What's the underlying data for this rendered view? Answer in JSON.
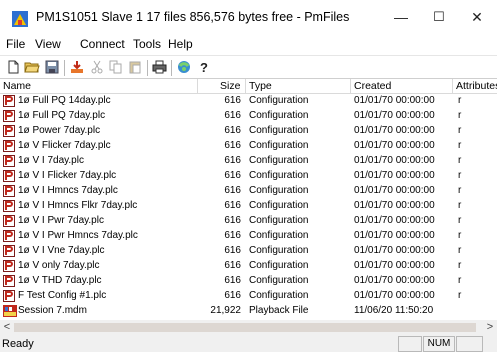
{
  "window": {
    "title": "PM1S1051 Slave 1 17 files 856,576 bytes free - PmFiles"
  },
  "window_controls": {
    "minimize": "—",
    "maximize": "☐",
    "close": "✕"
  },
  "menu": [
    "File",
    "View",
    "Connect",
    "Tools",
    "Help"
  ],
  "toolbar": [
    {
      "name": "new-icon"
    },
    {
      "name": "open-folder-icon"
    },
    {
      "name": "save-icon"
    },
    {
      "name": "download-icon"
    },
    {
      "name": "cut-icon"
    },
    {
      "name": "copy-icon"
    },
    {
      "name": "paste-icon"
    },
    {
      "name": "print-icon"
    },
    {
      "name": "connect-icon"
    },
    {
      "name": "help-icon"
    }
  ],
  "columns": {
    "name": "Name",
    "size": "Size",
    "type": "Type",
    "created": "Created",
    "attributes": "Attributes"
  },
  "files": [
    {
      "name": "1ø Full PQ 14day.plc",
      "size": "616",
      "type": "Configuration",
      "created": "01/01/70 00:00:00",
      "attr": "r",
      "icon": "plc-file-icon"
    },
    {
      "name": "1ø Full PQ 7day.plc",
      "size": "616",
      "type": "Configuration",
      "created": "01/01/70 00:00:00",
      "attr": "r",
      "icon": "plc-file-icon"
    },
    {
      "name": "1ø Power 7day.plc",
      "size": "616",
      "type": "Configuration",
      "created": "01/01/70 00:00:00",
      "attr": "r",
      "icon": "plc-file-icon"
    },
    {
      "name": "1ø V Flicker 7day.plc",
      "size": "616",
      "type": "Configuration",
      "created": "01/01/70 00:00:00",
      "attr": "r",
      "icon": "plc-file-icon"
    },
    {
      "name": "1ø V I 7day.plc",
      "size": "616",
      "type": "Configuration",
      "created": "01/01/70 00:00:00",
      "attr": "r",
      "icon": "plc-file-icon"
    },
    {
      "name": "1ø V I Flicker 7day.plc",
      "size": "616",
      "type": "Configuration",
      "created": "01/01/70 00:00:00",
      "attr": "r",
      "icon": "plc-file-icon"
    },
    {
      "name": "1ø V I Hmncs 7day.plc",
      "size": "616",
      "type": "Configuration",
      "created": "01/01/70 00:00:00",
      "attr": "r",
      "icon": "plc-file-icon"
    },
    {
      "name": "1ø V I Hmncs Flkr 7day.plc",
      "size": "616",
      "type": "Configuration",
      "created": "01/01/70 00:00:00",
      "attr": "r",
      "icon": "plc-file-icon"
    },
    {
      "name": "1ø V I Pwr 7day.plc",
      "size": "616",
      "type": "Configuration",
      "created": "01/01/70 00:00:00",
      "attr": "r",
      "icon": "plc-file-icon"
    },
    {
      "name": "1ø V I Pwr Hmncs 7day.plc",
      "size": "616",
      "type": "Configuration",
      "created": "01/01/70 00:00:00",
      "attr": "r",
      "icon": "plc-file-icon"
    },
    {
      "name": "1ø V I Vne 7day.plc",
      "size": "616",
      "type": "Configuration",
      "created": "01/01/70 00:00:00",
      "attr": "r",
      "icon": "plc-file-icon"
    },
    {
      "name": "1ø V only 7day.plc",
      "size": "616",
      "type": "Configuration",
      "created": "01/01/70 00:00:00",
      "attr": "r",
      "icon": "plc-file-icon"
    },
    {
      "name": "1ø V THD 7day.plc",
      "size": "616",
      "type": "Configuration",
      "created": "01/01/70 00:00:00",
      "attr": "r",
      "icon": "plc-file-icon"
    },
    {
      "name": "F Test Config #1.plc",
      "size": "616",
      "type": "Configuration",
      "created": "01/01/70 00:00:00",
      "attr": "r",
      "icon": "plc-file-icon"
    },
    {
      "name": "Session 7.mdm",
      "size": "21,922",
      "type": "Playback File",
      "created": "11/06/20 11:50:20",
      "attr": "",
      "icon": "mdm-file-icon"
    }
  ],
  "scrollbar": {
    "left": "<",
    "right": ">"
  },
  "status": {
    "text": "Ready",
    "num": "NUM"
  }
}
